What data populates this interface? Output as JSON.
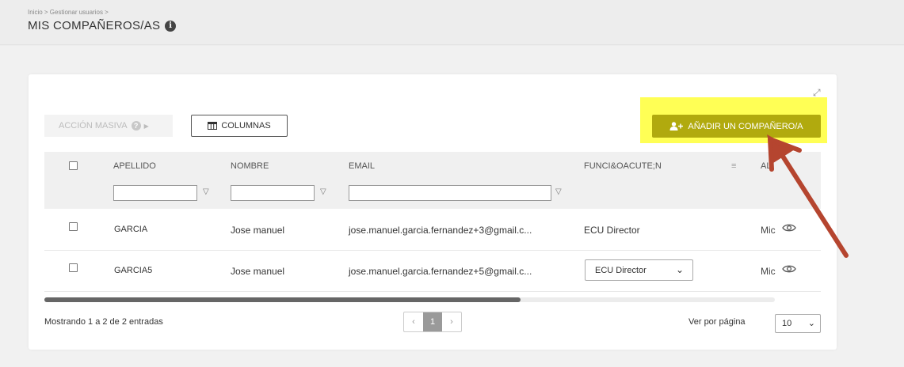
{
  "breadcrumb": "Inicio > Gestionar usuarios >",
  "page_title": "MIS COMPAÑEROS/AS",
  "toolbar": {
    "mass_action_label": "ACCIÓN MASIVA",
    "columns_label": "COLUMNAS",
    "add_label": "AÑADIR UN COMPAÑERO/A"
  },
  "table": {
    "headers": {
      "apellido": "APELLIDO",
      "nombre": "NOMBRE",
      "email": "EMAIL",
      "funcion": "FUNCI&OACUTE;N",
      "al": "AL"
    },
    "rows": [
      {
        "apellido": "GARCIA",
        "nombre": "Jose manuel",
        "email": "jose.manuel.garcia.fernandez+3@gmail.c...",
        "funcion": "ECU Director",
        "extra": "Mic"
      },
      {
        "apellido": "GARCIA5",
        "nombre": "Jose manuel",
        "email": "jose.manuel.garcia.fernandez+5@gmail.c...",
        "funcion": "ECU Director",
        "extra": "Mic"
      }
    ]
  },
  "footer": {
    "showing": "Mostrando 1 a 2 de 2 entradas",
    "prev": "‹",
    "page": "1",
    "next": "›",
    "per_page_label": "Ver por página",
    "per_page_value": "10"
  },
  "colors": {
    "add_button": "#b1aa0e",
    "highlight": "#ffff55",
    "arrow": "#b5452f"
  }
}
